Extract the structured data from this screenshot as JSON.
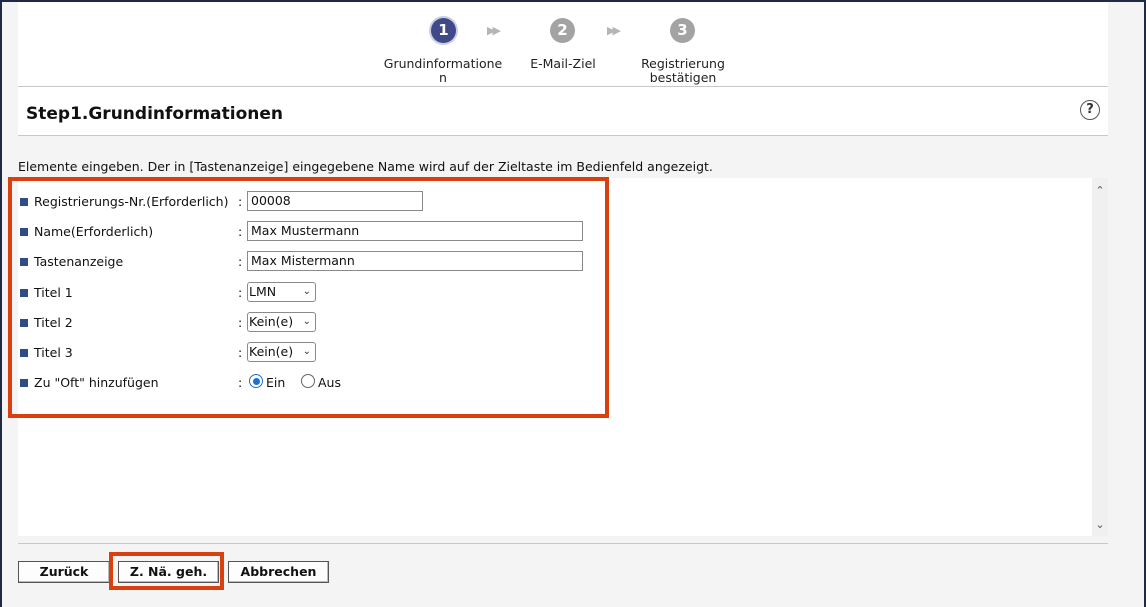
{
  "stepper": {
    "steps": [
      {
        "number": "1",
        "label": "Grundinformatione n",
        "label_line1": "Grundinformatione",
        "label_line2": "n",
        "state": "active"
      },
      {
        "number": "2",
        "label": "E-Mail-Ziel",
        "state": "inactive"
      },
      {
        "number": "3",
        "label": "Registrierung bestätigen",
        "label_line1": "Registrierung",
        "label_line2": "bestätigen",
        "state": "inactive"
      }
    ],
    "arrow": "▶▶"
  },
  "page": {
    "title": "Step1.Grundinformationen",
    "help": "?",
    "instruction": "Elemente eingeben. Der in [Tastenanzeige] eingegebene Name wird auf der Zieltaste im Bedienfeld angezeigt."
  },
  "form": {
    "colon": ":",
    "registration": {
      "label": "Registrierungs-Nr.(Erforderlich)",
      "value": "00008"
    },
    "name": {
      "label": "Name(Erforderlich)",
      "value": "Max Mustermann"
    },
    "key_display": {
      "label": "Tastenanzeige",
      "value": "Max Mistermann"
    },
    "title1": {
      "label": "Titel 1",
      "value": "LMN"
    },
    "title2": {
      "label": "Titel 2",
      "value": "Kein(e)"
    },
    "title3": {
      "label": "Titel 3",
      "value": "Kein(e)"
    },
    "favorites": {
      "label": "Zu \"Oft\" hinzufügen",
      "on_label": "Ein",
      "off_label": "Aus",
      "selected": "Ein"
    }
  },
  "buttons": {
    "back": "Zurück",
    "next": "Z. Nä. geh.",
    "cancel": "Abbrechen"
  },
  "colors": {
    "highlight": "#d9400f",
    "active_step": "#3f4a86",
    "bullet": "#2f4c84"
  },
  "icons": {
    "help": "help-icon",
    "scroll_up": "chevron-up-icon",
    "scroll_down": "chevron-down-icon",
    "select_caret": "chevron-down-icon"
  }
}
